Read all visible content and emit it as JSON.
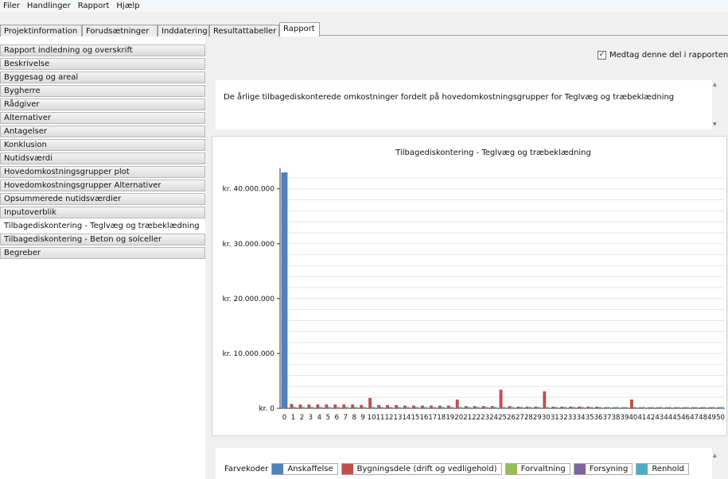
{
  "menu": [
    "Filer",
    "Handlinger",
    "Rapport",
    "Hjælp"
  ],
  "tabs": [
    {
      "label": "Projektinformation",
      "active": false
    },
    {
      "label": "Forudsætninger",
      "active": false
    },
    {
      "label": "Inddatering",
      "active": false
    },
    {
      "label": "Resultattabeller",
      "active": false
    },
    {
      "label": "Rapport",
      "active": true
    }
  ],
  "sidebar": {
    "items": [
      {
        "label": "Rapport indledning og overskrift",
        "active": false
      },
      {
        "label": "Beskrivelse",
        "active": false
      },
      {
        "label": "Byggesag og areal",
        "active": false
      },
      {
        "label": "Bygherre",
        "active": false
      },
      {
        "label": "Rådgiver",
        "active": false
      },
      {
        "label": "Alternativer",
        "active": false
      },
      {
        "label": "Antagelser",
        "active": false
      },
      {
        "label": "Konklusion",
        "active": false
      },
      {
        "label": "Nutidsværdi",
        "active": false
      },
      {
        "label": "Hovedomkostningsgrupper plot",
        "active": false
      },
      {
        "label": "Hovedomkostningsgrupper Alternativer",
        "active": false
      },
      {
        "label": "Opsummerede nutidsværdier",
        "active": false
      },
      {
        "label": "Inputoverblik",
        "active": false
      },
      {
        "label": "Tilbagediskontering - Teglvæg og træbeklædning",
        "active": true
      },
      {
        "label": "Tilbagediskontering - Beton og solceller",
        "active": false
      },
      {
        "label": "Begreber",
        "active": false
      }
    ]
  },
  "include": {
    "label": "Medtag denne del i rapporten",
    "checked": true
  },
  "description": "De årlige tilbagediskonterede omkostninger fordelt på hovedomkostningsgrupper for Teglvæg og træbeklædning",
  "legend": {
    "title": "Farvekoder",
    "items": [
      {
        "label": "Anskaffelse",
        "color": "#4f81bd"
      },
      {
        "label": "Bygningsdele (drift og vedligehold)",
        "color": "#c0504d"
      },
      {
        "label": "Forvaltning",
        "color": "#9bbb59"
      },
      {
        "label": "Forsyning",
        "color": "#8064a2"
      },
      {
        "label": "Renhold",
        "color": "#4bacc6"
      }
    ]
  },
  "chart_data": {
    "type": "bar",
    "title": "Tilbagediskontering - Teglvæg og træbeklædning",
    "xlabel": "",
    "ylabel": "",
    "ylim": [
      0,
      43000000
    ],
    "grid": true,
    "categories": [
      "0",
      "1",
      "2",
      "3",
      "4",
      "5",
      "6",
      "7",
      "8",
      "9",
      "10",
      "11",
      "12",
      "13",
      "14",
      "15",
      "16",
      "17",
      "18",
      "19",
      "20",
      "21",
      "22",
      "23",
      "24",
      "25",
      "26",
      "27",
      "28",
      "29",
      "30",
      "31",
      "32",
      "33",
      "34",
      "35",
      "36",
      "37",
      "38",
      "39",
      "40",
      "41",
      "42",
      "43",
      "44",
      "45",
      "46",
      "47",
      "48",
      "49",
      "50"
    ],
    "yticks": [
      "kr. 0",
      "kr. 10.000.000",
      "kr. 20.000.000",
      "kr. 30.000.000",
      "kr. 40.000.000"
    ],
    "ytick_values": [
      0,
      10000000,
      20000000,
      30000000,
      40000000
    ],
    "series": [
      {
        "name": "Anskaffelse",
        "color": "#4f81bd",
        "values": [
          43000000,
          0,
          0,
          0,
          0,
          0,
          0,
          0,
          0,
          0,
          0,
          0,
          0,
          0,
          0,
          0,
          0,
          0,
          0,
          0,
          0,
          0,
          0,
          0,
          0,
          0,
          0,
          0,
          0,
          0,
          0,
          0,
          0,
          0,
          0,
          0,
          0,
          0,
          0,
          0,
          0,
          0,
          0,
          0,
          0,
          0,
          0,
          0,
          0,
          0,
          0
        ]
      },
      {
        "name": "Bygningsdele (drift og vedligehold)",
        "color": "#c0504d",
        "values": [
          0,
          800000,
          700000,
          700000,
          700000,
          700000,
          700000,
          700000,
          700000,
          600000,
          1900000,
          600000,
          600000,
          600000,
          500000,
          500000,
          500000,
          500000,
          500000,
          500000,
          1600000,
          400000,
          400000,
          400000,
          400000,
          3400000,
          400000,
          300000,
          300000,
          300000,
          3100000,
          300000,
          300000,
          300000,
          300000,
          300000,
          300000,
          200000,
          200000,
          200000,
          1600000,
          200000,
          200000,
          200000,
          200000,
          200000,
          200000,
          200000,
          200000,
          200000,
          200000
        ]
      },
      {
        "name": "Forvaltning",
        "color": "#9bbb59",
        "values": [
          0,
          0,
          0,
          0,
          0,
          0,
          0,
          0,
          0,
          0,
          0,
          0,
          0,
          0,
          0,
          0,
          0,
          0,
          0,
          0,
          0,
          0,
          0,
          0,
          0,
          0,
          0,
          0,
          0,
          0,
          0,
          0,
          0,
          0,
          0,
          0,
          0,
          0,
          0,
          0,
          0,
          0,
          0,
          0,
          0,
          0,
          0,
          0,
          0,
          0,
          0
        ]
      },
      {
        "name": "Forsyning",
        "color": "#8064a2",
        "values": [
          0,
          0,
          0,
          0,
          0,
          0,
          0,
          0,
          0,
          0,
          0,
          0,
          0,
          0,
          0,
          0,
          0,
          0,
          0,
          0,
          0,
          0,
          0,
          0,
          0,
          0,
          0,
          0,
          0,
          0,
          0,
          0,
          0,
          0,
          0,
          0,
          0,
          0,
          0,
          0,
          0,
          0,
          0,
          0,
          0,
          0,
          0,
          0,
          0,
          0,
          0
        ]
      },
      {
        "name": "Renhold",
        "color": "#4bacc6",
        "values": [
          0,
          250000,
          250000,
          250000,
          250000,
          250000,
          250000,
          250000,
          250000,
          250000,
          250000,
          250000,
          250000,
          250000,
          250000,
          250000,
          250000,
          250000,
          250000,
          250000,
          250000,
          250000,
          250000,
          250000,
          250000,
          250000,
          250000,
          250000,
          250000,
          250000,
          250000,
          250000,
          250000,
          250000,
          250000,
          250000,
          250000,
          250000,
          250000,
          250000,
          250000,
          250000,
          250000,
          250000,
          250000,
          250000,
          250000,
          250000,
          250000,
          250000,
          250000
        ]
      }
    ]
  }
}
